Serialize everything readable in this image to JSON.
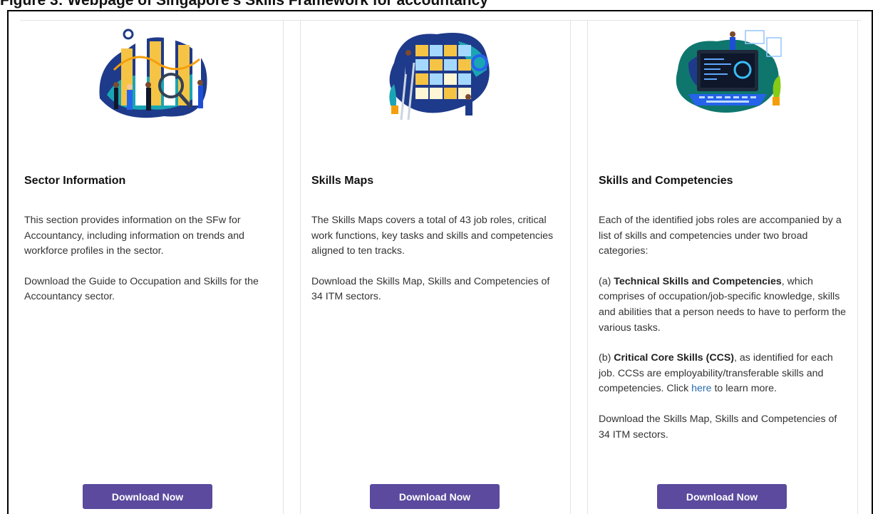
{
  "figure_caption": "Figure 3: Webpage of Singapore's Skills Framework for accountancy",
  "columns": [
    {
      "title": "Sector Information",
      "paragraphs": [
        "This section provides information on the SFw for Accountancy, including information on trends and workforce profiles in the sector.",
        "Download the Guide to Occupation and Skills for the Accountancy sector."
      ],
      "button_label": "Download Now",
      "illustration": "data-analysis-illustration"
    },
    {
      "title": "Skills Maps",
      "paragraphs": [
        "The Skills Maps covers a total of 43 job roles, critical work functions, key tasks and skills and competencies aligned to ten tracks.",
        "Download the Skills Map, Skills and Competencies of 34 ITM sectors."
      ],
      "button_label": "Download Now",
      "illustration": "planning-board-illustration"
    },
    {
      "title": "Skills and Competencies",
      "intro": "Each of the identified jobs roles are accompanied by a list of skills and competencies under two broad categories:",
      "item_a_prefix": "(a) ",
      "item_a_bold": "Technical Skills and Competencies",
      "item_a_rest": ", which comprises of occupation/job-specific knowledge, skills and abilities that a person needs to have to perform the various tasks.",
      "item_b_prefix": "(b) ",
      "item_b_bold": "Critical Core Skills (CCS)",
      "item_b_rest": ", as identified for each job. CCSs are employability/transferable skills and competencies. Click ",
      "item_b_link": "here",
      "item_b_end": " to learn more.",
      "outro": "Download the Skills Map, Skills and Competencies of 34 ITM sectors.",
      "button_label": "Download Now",
      "illustration": "laptop-developer-illustration"
    }
  ],
  "colors": {
    "button": "#5b4a9e",
    "link": "#2b6cb0",
    "illustration_blue": "#1e3a8a",
    "illustration_teal": "#1aa5b4",
    "illustration_yellow": "#f6c445"
  }
}
